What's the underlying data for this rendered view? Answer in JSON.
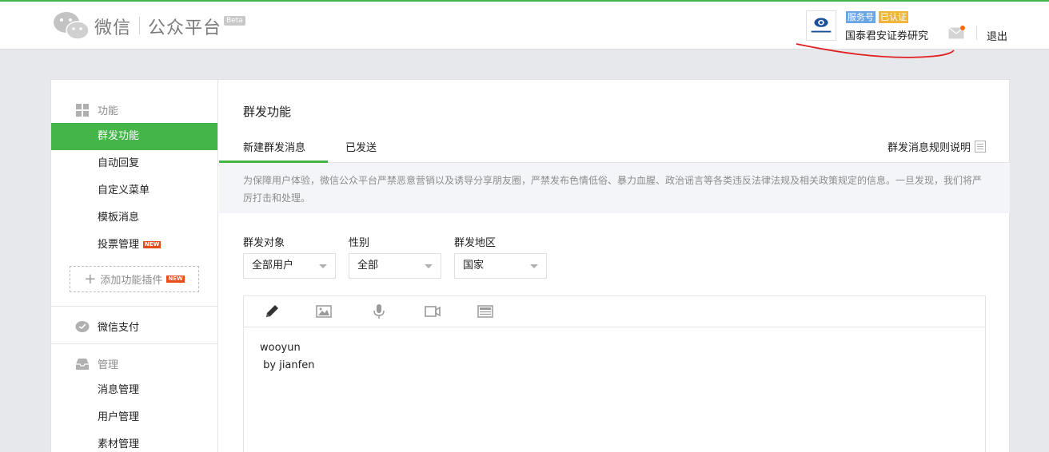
{
  "header": {
    "brand": "微信",
    "product": "公众平台",
    "beta": "Beta",
    "account_type": "服务号",
    "verified": "已认证",
    "account_name": "国泰君安证券研究",
    "logout": "退出",
    "icons": {
      "logo": "wechat-logo-icon",
      "mail": "mail-icon"
    }
  },
  "sidebar": {
    "sections": [
      {
        "title": "功能",
        "icon": "grid-icon"
      },
      {
        "title": "微信支付",
        "icon": "wallet-icon"
      },
      {
        "title": "管理",
        "icon": "inbox-icon"
      }
    ],
    "function_items": [
      "群发功能",
      "自动回复",
      "自定义菜单",
      "模板消息",
      "投票管理"
    ],
    "new_badge": "NEW",
    "add_plugin": "添加功能插件",
    "manage_items": [
      "消息管理",
      "用户管理",
      "素材管理"
    ]
  },
  "main": {
    "title": "群发功能",
    "tabs": [
      "新建群发消息",
      "已发送"
    ],
    "rules_link": "群发消息规则说明",
    "notice": "为保障用户体验，微信公众平台严禁恶意营销以及诱导分享朋友圈，严禁发布色情低俗、暴力血腥、政治谣言等各类违反法律法规及相关政策规定的信息。一旦发现，我们将严厉打击和处理。",
    "filters": [
      {
        "label": "群发对象",
        "value": "全部用户"
      },
      {
        "label": "性别",
        "value": "全部"
      },
      {
        "label": "群发地区",
        "value": "国家"
      }
    ],
    "editor_tools": [
      "pencil-icon",
      "image-icon",
      "microphone-icon",
      "video-icon",
      "article-icon"
    ],
    "editor_content": "wooyun\n by jianfen"
  },
  "colors": {
    "accent": "#44b549",
    "badge_new": "#e84d19",
    "tag_service": "#6aa6e4",
    "tag_verified": "#f0b63b",
    "annotation": "#e02020"
  }
}
